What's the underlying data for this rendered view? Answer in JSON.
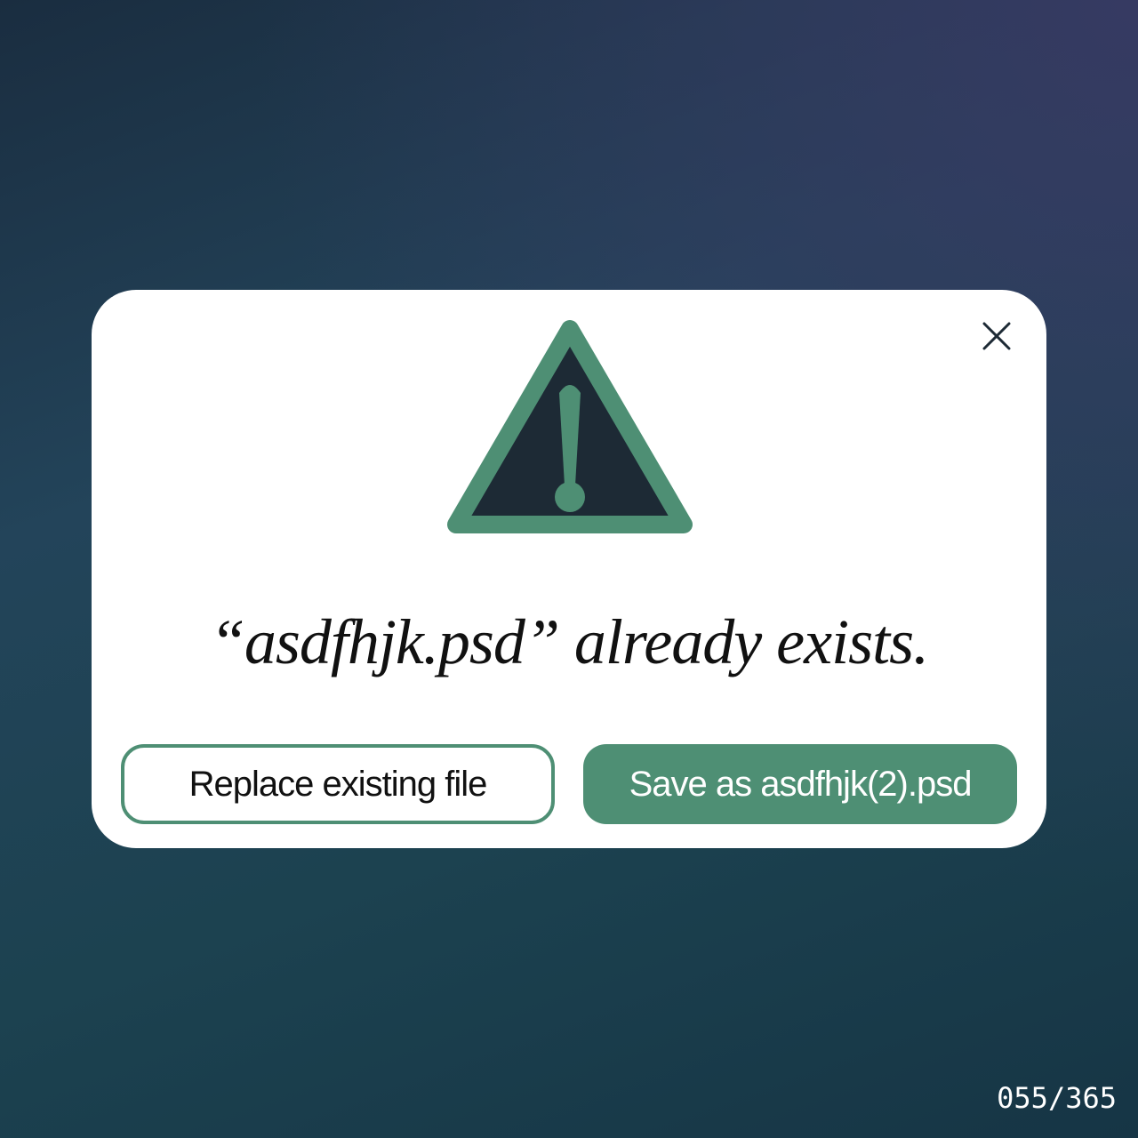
{
  "dialog": {
    "message": "“asdfhjk.psd” already exists.",
    "replace_label": "Replace existing file",
    "save_as_label": "Save as asdfhjk(2).psd",
    "icons": [
      "warning-icon",
      "close-icon"
    ]
  },
  "counter": "055/365",
  "colors": {
    "accent": "#4e8f74",
    "icon_fill": "#1d2a35"
  }
}
